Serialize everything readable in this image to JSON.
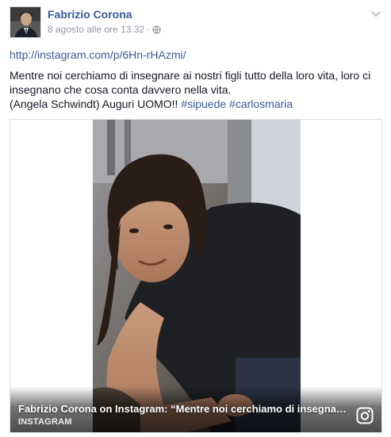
{
  "post": {
    "author": "Fabrizio Corona",
    "timestamp": "8 agosto alle ore 13.32",
    "separator": "·",
    "privacy_icon": "globe-icon",
    "options_icon": "chevron-down-icon",
    "link": "http://instagram.com/p/6Hn-rHAzmi/",
    "text_line1": "Mentre noi cerchiamo di insegnare ai nostri figli tutto della loro vita, loro ci",
    "text_line2": "insegnano che cosa conta davvero nella vita.",
    "text_line3": "(Angela Schwindt) Auguri UOMO!! ",
    "hashtags": [
      "#sipuede",
      "#carlosmaria"
    ]
  },
  "attachment": {
    "title": "Fabrizio Corona on Instagram: “Mentre noi cerchiamo di insegnare ai nostri figli tutto della loro vita",
    "source": "INSTAGRAM",
    "source_icon": "instagram-icon"
  },
  "colors": {
    "link": "#3b5998",
    "meta": "#9197a3",
    "text": "#141823"
  }
}
